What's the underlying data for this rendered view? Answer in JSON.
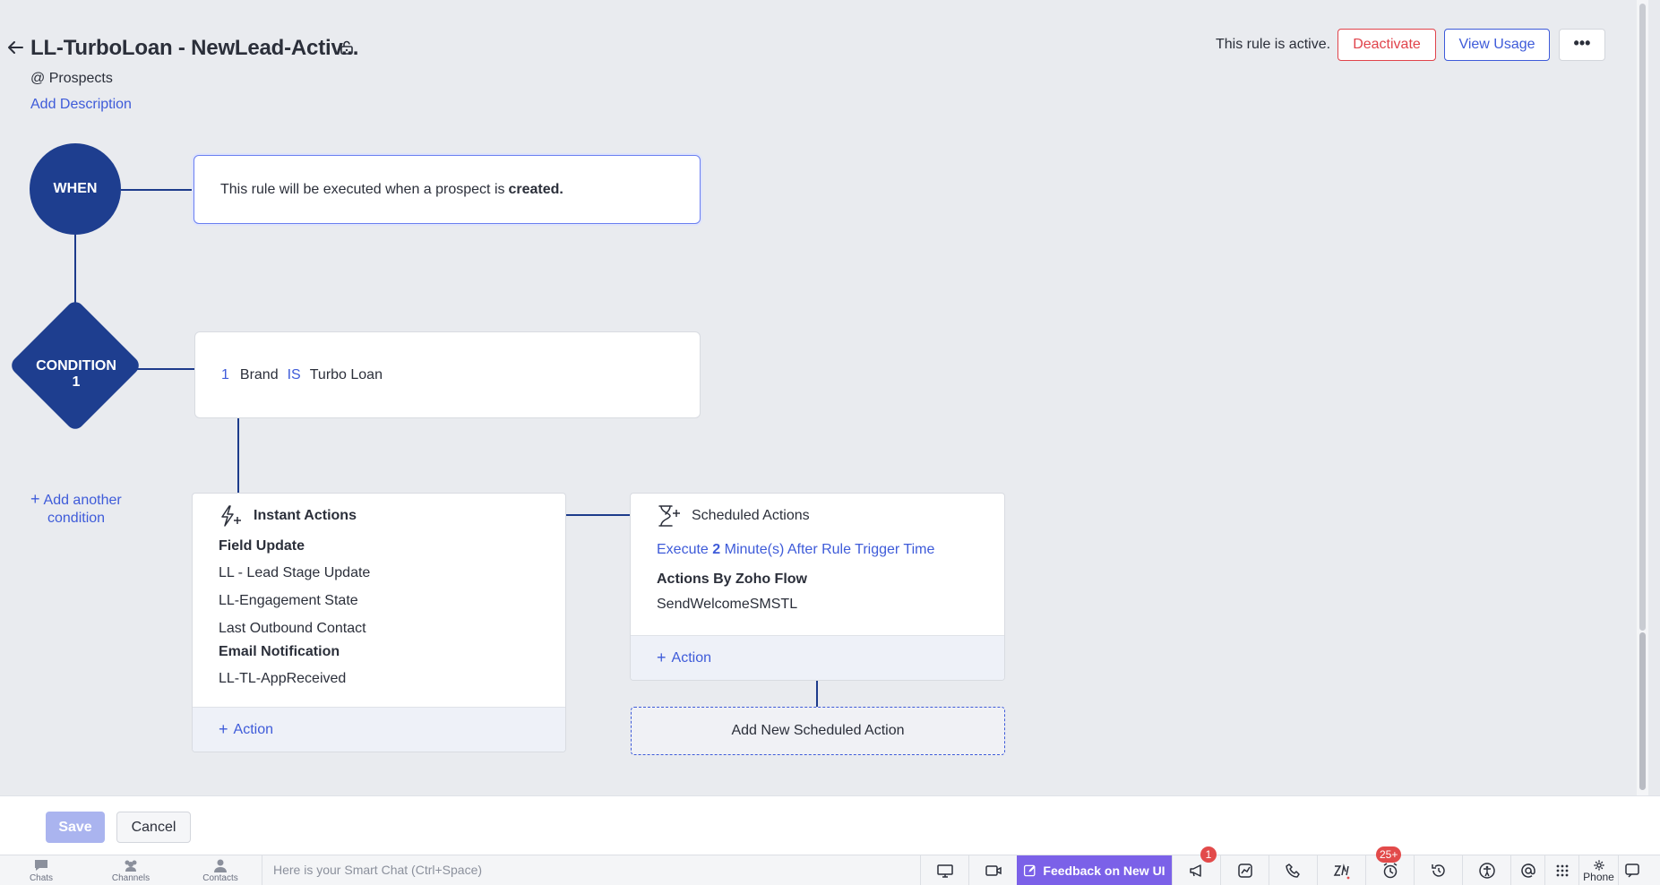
{
  "header": {
    "title": "LL-TurboLoan - NewLead-Activ...",
    "module": "@ Prospects",
    "add_description": "Add Description",
    "status_text": "This rule is active.",
    "deactivate_label": "Deactivate",
    "view_usage_label": "View Usage",
    "more_label": "•••"
  },
  "when": {
    "node_label": "WHEN",
    "text_prefix": "This rule will be executed when a prospect is",
    "text_bold": "created."
  },
  "condition": {
    "node_label_line1": "CONDITION",
    "node_label_line2": "1",
    "criteria_number": "1",
    "criteria_field": "Brand",
    "criteria_operator": "IS",
    "criteria_value": "Turbo Loan",
    "add_another_line1": "Add another",
    "add_another_line2": "condition"
  },
  "instant_actions": {
    "title": "Instant Actions",
    "groups": [
      {
        "title": "Field Update",
        "items": [
          "LL - Lead Stage Update",
          "LL-Engagement State",
          "Last Outbound Contact"
        ]
      },
      {
        "title": "Email Notification",
        "items": [
          "LL-TL-AppReceived"
        ]
      }
    ],
    "add_action": "Action"
  },
  "scheduled_actions": {
    "title": "Scheduled Actions",
    "exec_prefix": "Execute",
    "exec_value": "2",
    "exec_suffix": "Minute(s) After Rule Trigger Time",
    "group_title": "Actions By Zoho Flow",
    "group_item": "SendWelcomeSMSTL",
    "add_action": "Action",
    "add_new_scheduled": "Add New Scheduled Action"
  },
  "footer": {
    "save_label": "Save",
    "cancel_label": "Cancel"
  },
  "taskbar": {
    "chats": "Chats",
    "channels": "Channels",
    "contacts": "Contacts",
    "smart_chat_placeholder": "Here is your Smart Chat (Ctrl+Space)",
    "feedback_label": "Feedback on New UI",
    "announcements_badge": "1",
    "reminders_badge": "25+",
    "phone_label": "Phone"
  },
  "colors": {
    "accent": "#3e5bd9",
    "node": "#1e3e8f",
    "danger": "#e0434b",
    "feedback": "#7b61e8"
  }
}
